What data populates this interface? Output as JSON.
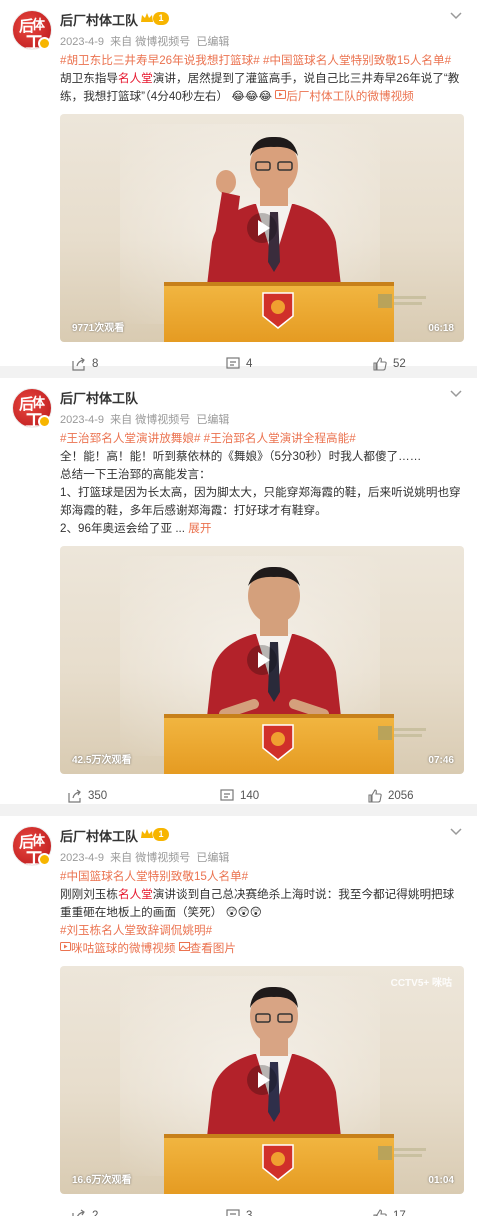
{
  "posts": [
    {
      "author": "后厂村体工队",
      "level": "1",
      "date": "2023-4-9",
      "source": "来自 微博视频号",
      "edited": "已编辑",
      "tags": [
        "#胡卫东比三井寿早26年说我想打篮球#",
        "#中国篮球名人堂特别致敬15人名单#"
      ],
      "text_a": "胡卫东指导",
      "text_hl": "名人堂",
      "text_b": "演讲，居然提到了灌篮高手，说自己比三井寿早26年说了“教练，我想打篮球”（4分40秒左右）",
      "emoji": "😂😂😂",
      "link": "后厂村体工队的微博视频",
      "views": "9771次观看",
      "duration": "06:18",
      "shares": "8",
      "comments": "4",
      "likes": "52"
    },
    {
      "author": "后厂村体工队",
      "date": "2023-4-9",
      "source": "来自 微博视频号",
      "edited": "已编辑",
      "tags": [
        "#王治郅名人堂演讲放舞娘#",
        "#王治郅名人堂演讲全程高能#"
      ],
      "line1": "全！能！高！能！听到蔡依林的《舞娘》（5分30秒）时我人都傻了……",
      "line2": "总结一下王治郅的高能发言：",
      "line3": "1、打篮球是因为长太高，因为脚太大，只能穿郑海霞的鞋，后来听说姚明也穿郑海霞的鞋，多年后感谢郑海霞：打好球才有鞋穿。",
      "line4": "2、96年奥运会给了亚 ...",
      "expand": "展开",
      "views": "42.5万次观看",
      "duration": "07:46",
      "shares": "350",
      "comments": "140",
      "likes": "2056"
    },
    {
      "author": "后厂村体工队",
      "level": "1",
      "date": "2023-4-9",
      "source": "来自 微博视频号",
      "edited": "已编辑",
      "tag1": "#中国篮球名人堂特别致敬15人名单#",
      "text_a": "刚刚刘玉栋",
      "text_hl": "名人堂",
      "text_b": "演讲谈到自己总决赛绝杀上海时说：我至今都记得姚明把球重重砸在地板上的画面（笑死）",
      "emoji": "😲😲😲",
      "tag2": "#刘玉栋名人堂致辞调侃姚明#",
      "link": "咪咕篮球的微博视频",
      "link2": "查看图片",
      "cctv": "CCTV5+ 咪咕",
      "views": "16.6万次观看",
      "duration": "01:04",
      "shares": "2",
      "comments": "3",
      "likes": "17"
    }
  ],
  "colors": {
    "tag": "#eb7350",
    "highlight": "#e6162d",
    "gold": "#f7b500",
    "avatar": "#d42a26"
  }
}
